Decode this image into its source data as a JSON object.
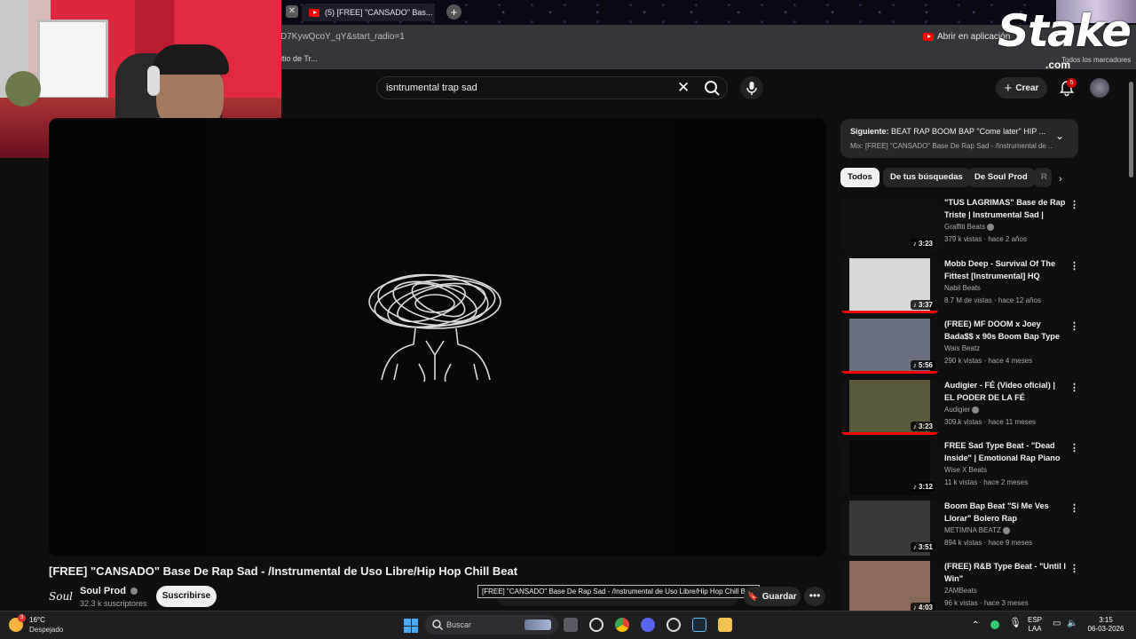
{
  "browser": {
    "tab_title": "(5) [FREE] \"CANSADO\" Bas...",
    "url": "D7KywQcoY_qY&start_radio=1",
    "open_app": "Abrir en aplicación",
    "bookmark": "itio de Tr...",
    "bookmark_right": "Todos los marcadores"
  },
  "overlay": {
    "stake_logo": "Stake",
    "stake_domain": ".com"
  },
  "header": {
    "search_value": "isntrumental trap sad",
    "create_label": "Crear",
    "notifications_count": "5"
  },
  "video": {
    "title": "[FREE] \"CANSADO\" Base De Rap Sad - /Instrumental de Uso Libre/Hip Hop Chill Beat",
    "channel_logo_text": "Soul",
    "channel": "Soul Prod",
    "subscribers": "32.3 k suscriptores",
    "subscribe_label": "Suscribirse",
    "save_label": "Guardar",
    "tooltip": "[FREE] \"CANSADO\"  Base De Rap Sad - /Instrumental de Uso Libre/Hip Hop Chill Beat"
  },
  "sidebar": {
    "next_label": "Siguiente:",
    "next_title": "BEAT RAP BOOM BAP \"Come later\" HIP ...",
    "mix_title": "Mix: [FREE] \"CANSADO\" Base De Rap Sad - /Instrumental de ...",
    "chips": [
      "Todos",
      "De tus búsquedas",
      "De Soul Prod",
      "R"
    ],
    "recommendations": [
      {
        "title": "\"TUS LAGRIMAS\" Base de Rap Triste | Instrumental Sad | Pian...",
        "channel": "Graffiti Beats",
        "verified": true,
        "meta": "379 k vistas · hace 2 años",
        "duration": "3:23",
        "progress": 0,
        "thumb_color": "#101010"
      },
      {
        "title": "Mobb Deep - Survival Of The Fittest [Instrumental] HQ",
        "channel": "Nabil Beats",
        "verified": false,
        "meta": "8.7 M de vistas · hace 12 años",
        "duration": "3:37",
        "progress": 1.0,
        "thumb_color": "#d8d8d8"
      },
      {
        "title": "(FREE) MF DOOM x Joey Bada$$ x 90s Boom Bap Type ...",
        "channel": "Wais Beatz",
        "verified": false,
        "meta": "290 k vistas · hace 4 meses",
        "duration": "5:56",
        "progress": 1.0,
        "thumb_color": "#6a7080"
      },
      {
        "title": "Audigier - FÉ (Video oficial) | EL PODER DE LA FÉ",
        "channel": "Audigier",
        "verified": true,
        "meta": "309 k vistas · hace 11 meses",
        "duration": "3:23",
        "progress": 1.0,
        "thumb_color": "#5a5a3a"
      },
      {
        "title": "FREE Sad Type Beat - \"Dead Inside\" | Emotional Rap Piano ...",
        "channel": "Wise X Beats",
        "verified": false,
        "meta": "11 k vistas · hace 2 meses",
        "duration": "3:12",
        "progress": 0,
        "thumb_color": "#0a0a0a"
      },
      {
        "title": "Boom Bap Beat \"Si Me Ves Llorar\" Bolero Rap",
        "channel": "METIMNA BEATZ",
        "verified": true,
        "meta": "894 k vistas · hace 9 meses",
        "duration": "3:51",
        "progress": 0,
        "thumb_color": "#3a3a3a"
      },
      {
        "title": "(FREE) R&B Type Beat - \"Until I Win\"",
        "channel": "2AMBeats",
        "verified": false,
        "meta": "96 k vistas · hace 3 meses",
        "duration": "4:03",
        "progress": 0,
        "thumb_color": "#8a6a5a"
      }
    ]
  },
  "taskbar": {
    "temperature": "16°C",
    "weather": "Despejado",
    "weather_badge": "3",
    "search_label": "Buscar",
    "lang": "ESP",
    "layout": "LAA",
    "time": "3:15",
    "date": "06-03-2026"
  }
}
